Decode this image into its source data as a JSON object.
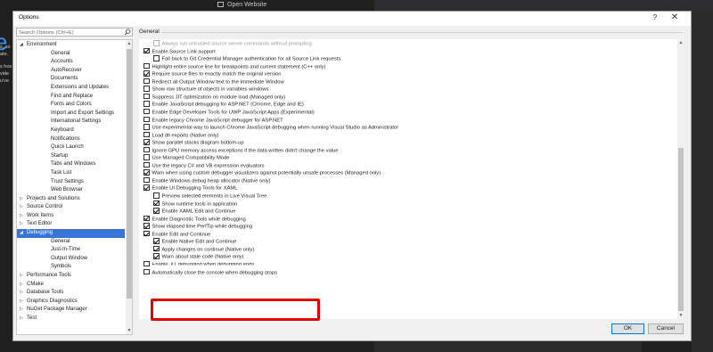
{
  "background": {
    "open_website": "Open Website",
    "left_fragments": [
      "s, so",
      "ate.",
      "s hos",
      "vide",
      "u've"
    ]
  },
  "window": {
    "title": "Options",
    "help": "?",
    "close": "✕"
  },
  "search": {
    "placeholder": "Search Options (Ctrl+E)",
    "icon": "search-icon"
  },
  "tree": [
    {
      "label": "Environment",
      "level": 0,
      "arrow": "◢"
    },
    {
      "label": "General",
      "level": 1
    },
    {
      "label": "Accounts",
      "level": 1
    },
    {
      "label": "AutoRecover",
      "level": 1
    },
    {
      "label": "Documents",
      "level": 1
    },
    {
      "label": "Extensions and Updates",
      "level": 1
    },
    {
      "label": "Find and Replace",
      "level": 1
    },
    {
      "label": "Fonts and Colors",
      "level": 1
    },
    {
      "label": "Import and Export Settings",
      "level": 1
    },
    {
      "label": "International Settings",
      "level": 1
    },
    {
      "label": "Keyboard",
      "level": 1
    },
    {
      "label": "Notifications",
      "level": 1
    },
    {
      "label": "Quick Launch",
      "level": 1
    },
    {
      "label": "Startup",
      "level": 1
    },
    {
      "label": "Tabs and Windows",
      "level": 1
    },
    {
      "label": "Task List",
      "level": 1
    },
    {
      "label": "Trust Settings",
      "level": 1
    },
    {
      "label": "Web Browser",
      "level": 1
    },
    {
      "label": "Projects and Solutions",
      "level": 0,
      "arrow": "▷"
    },
    {
      "label": "Source Control",
      "level": 0,
      "arrow": "▷"
    },
    {
      "label": "Work Items",
      "level": 0,
      "arrow": "▷"
    },
    {
      "label": "Text Editor",
      "level": 0,
      "arrow": "▷"
    },
    {
      "label": "Debugging",
      "level": 0,
      "arrow": "◢",
      "selected": true
    },
    {
      "label": "General",
      "level": 1
    },
    {
      "label": "Just-In-Time",
      "level": 1
    },
    {
      "label": "Output Window",
      "level": 1
    },
    {
      "label": "Symbols",
      "level": 1
    },
    {
      "label": "Performance Tools",
      "level": 0,
      "arrow": "▷"
    },
    {
      "label": "CMake",
      "level": 0,
      "arrow": "▷"
    },
    {
      "label": "Database Tools",
      "level": 0,
      "arrow": "▷"
    },
    {
      "label": "Graphics Diagnostics",
      "level": 0,
      "arrow": "▷"
    },
    {
      "label": "NuGet Package Manager",
      "level": 0,
      "arrow": "▷"
    },
    {
      "label": "Test",
      "level": 0,
      "arrow": "▷"
    }
  ],
  "section": {
    "title": "General"
  },
  "options": [
    {
      "label": "Always run untrusted source server commands without prompting",
      "checked": false,
      "indent": 1,
      "disabled": true
    },
    {
      "label": "Enable Source Link support",
      "checked": true,
      "indent": 0
    },
    {
      "label": "Fall back to Git Credential Manager authentication for all Source Link requests",
      "checked": false,
      "indent": 1
    },
    {
      "label": "Highlight entire source line for breakpoints and current statement (C++ only)",
      "checked": false,
      "indent": 0
    },
    {
      "label": "Require source files to exactly match the original version",
      "checked": true,
      "indent": 0
    },
    {
      "label": "Redirect all Output Window text to the Immediate Window",
      "checked": false,
      "indent": 0
    },
    {
      "label": "Show raw structure of objects in variables windows",
      "checked": false,
      "indent": 0
    },
    {
      "label": "Suppress JIT optimization on module load (Managed only)",
      "checked": false,
      "indent": 0
    },
    {
      "label": "Enable JavaScript debugging for ASP.NET (Chrome, Edge and IE)",
      "checked": false,
      "indent": 0
    },
    {
      "label": "Enable Edge Developer Tools for UWP JavaScript Apps (Experimental)",
      "checked": false,
      "indent": 0
    },
    {
      "label": "Enable legacy Chrome JavaScript debugger for ASP.NET",
      "checked": false,
      "indent": 0
    },
    {
      "label": "Use experimental way to launch Chrome JavaScript debugging when running Visual Studio as Administrator",
      "checked": false,
      "indent": 0
    },
    {
      "label": "Load dll exports (Native only)",
      "checked": false,
      "indent": 0
    },
    {
      "label": "Show parallel stacks diagram bottom-up",
      "checked": true,
      "indent": 0
    },
    {
      "label": "Ignore GPU memory access exceptions if the data written didn't change the value",
      "checked": false,
      "indent": 0
    },
    {
      "label": "Use Managed Compatibility Mode",
      "checked": false,
      "indent": 0
    },
    {
      "label": "Use the legacy C# and VB expression evaluators",
      "checked": false,
      "indent": 0
    },
    {
      "label": "Warn when using custom debugger visualizers against potentially unsafe processes (Managed only)",
      "checked": true,
      "indent": 0
    },
    {
      "label": "Enable Windows debug heap allocator (Native only)",
      "checked": false,
      "indent": 0
    },
    {
      "label": "Enable UI Debugging Tools for XAML",
      "checked": true,
      "indent": 0
    },
    {
      "label": "Preview selected elements in Live Visual Tree",
      "checked": false,
      "indent": 1
    },
    {
      "label": "Show runtime tools in application",
      "checked": true,
      "indent": 1
    },
    {
      "label": "Enable XAML Edit and Continue",
      "checked": true,
      "indent": 1
    },
    {
      "label": "Enable Diagnostic Tools while debugging",
      "checked": true,
      "indent": 0
    },
    {
      "label": "Show elapsed time PerfTip while debugging",
      "checked": true,
      "indent": 0
    },
    {
      "label": "Enable Edit and Continue",
      "checked": true,
      "indent": 0
    },
    {
      "label": "Enable Native Edit and Continue",
      "checked": true,
      "indent": 1
    },
    {
      "label": "Apply changes on continue (Native only)",
      "checked": true,
      "indent": 1
    },
    {
      "label": "Warn about stale code (Native only)",
      "checked": true,
      "indent": 1
    },
    {
      "label": "Enable JIT debugging when debugging ends",
      "checked": false,
      "indent": 0,
      "obscured": true
    },
    {
      "label": "Automatically close the console when debugging stops",
      "checked": false,
      "indent": 0
    }
  ],
  "buttons": {
    "ok": "OK",
    "cancel": "Cancel"
  },
  "colors": {
    "selection": "#3875d7",
    "highlight_box": "#e10000",
    "ok_border": "#0078d7"
  }
}
